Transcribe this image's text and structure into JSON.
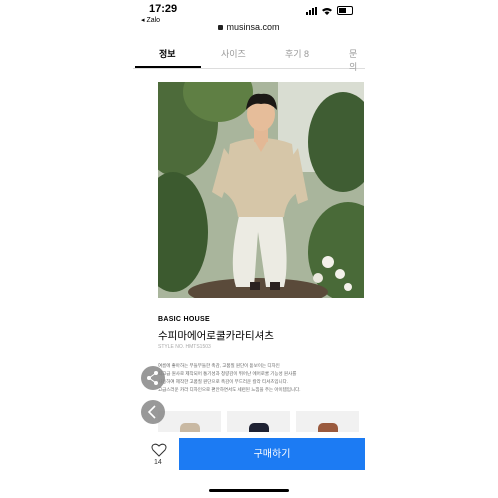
{
  "status": {
    "time": "17:29",
    "back_app": "◂ Zalo"
  },
  "url": "musinsa.com",
  "tabs": [
    {
      "label": "정보",
      "active": true
    },
    {
      "label": "사이즈",
      "active": false
    },
    {
      "label": "후기 8",
      "active": false
    },
    {
      "label": "문의",
      "active": false
    }
  ],
  "product": {
    "brand": "BASIC HOUSE",
    "name": "수피마에어로쿨카라티셔츠",
    "style_no": "STYLE NO. HMTS1503",
    "description_lines": [
      "여름에 좋아하는 부들부들한 촉감, 고품질 원단이 돋보이는 디자인",
      "최고급 원사로 제작되어 통기성과 청량감이 뛰어난 에어로쿨 기능성 원사를",
      "사용하여 제작한 고품질 원단으로 촉감이 부드러운 칼라 티셔츠입니다.",
      "고급스러운 카라 디자인으로 편안하면서도 세련된 느낌을 주는 아이템입니다."
    ]
  },
  "thumb_colors": [
    "#c9b9a3",
    "#1f2233",
    "#9a5a3e"
  ],
  "bottom": {
    "like_count": "14",
    "buy_label": "구매하기"
  },
  "colors": {
    "accent": "#1c7bf3"
  }
}
